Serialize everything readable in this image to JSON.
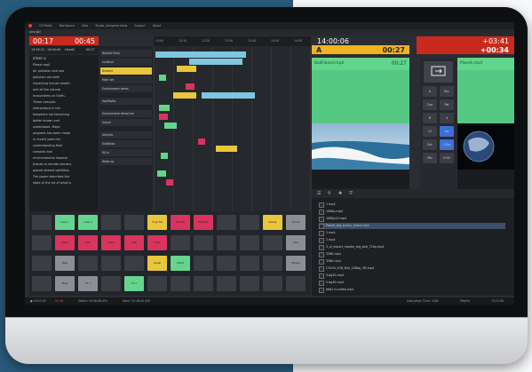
{
  "menubar": {
    "app": "OS Radio",
    "items": [
      "Workspace",
      "Help",
      "Studio, designed show",
      "Support",
      "About"
    ]
  },
  "subbar": {
    "label": "one.gbl"
  },
  "left": {
    "time_left": "00:17",
    "time_right": "00:45",
    "head": [
      "13:59:31",
      "14:00:06",
      "Head2",
      "00:17"
    ],
    "script_title": "STEST 4",
    "script_lines": [
      "Planet.mp4",
      "Air pollution and sea",
      "pollution are both",
      "impacting human health",
      "and all the natural",
      "ecosystems on Earth.",
      "These complex",
      "interactions in the",
      "biosphere are becoming",
      "better known and",
      "understood. Major",
      "progress has been made",
      "in recent years for",
      "understanding their",
      "complex and",
      "environmental impacts",
      "thanks to remote sensors",
      "placed aboard satellites.",
      "The paper describes the",
      "state of the art of what is"
    ]
  },
  "playlist": {
    "items": [
      "Ball/fall 5min",
      "Lo-Band",
      "Breaker",
      "Main set",
      "Environment demo",
      "Vox/Radio",
      "Environment demo live",
      "Sound",
      "Ad/intro",
      "Ext/News",
      "Fill-in",
      "Wake up"
    ]
  },
  "timeline": {
    "ticks": [
      "13:00",
      "13:10",
      "13:20",
      "13:30",
      "13:40",
      "13:50",
      "14:00"
    ]
  },
  "right": {
    "clock": "14:00:06",
    "countdown": "+03:41",
    "deck_a_letter": "A",
    "deck_a_time": "00:27",
    "deck_b_time": "+00:34",
    "deck_a_file": "BallFlared.mp4",
    "deck_a_duration": "00:27",
    "deck_b_file": "Planet.mp4",
    "deck_b_duration": "",
    "controls": [
      "A",
      "Esc",
      "Cue",
      "Pst",
      "B",
      "4",
      "12",
      "Ins",
      "Ext",
      "F-Out",
      "Mix",
      "0:00"
    ]
  },
  "pads": {
    "labels": [
      "Loop 1",
      "Loop 2",
      "Loop 3",
      "Loop 4",
      "Vinyl Hit",
      "Top Hit",
      "Fanfare",
      "Sweep",
      "Chime",
      "Alarm",
      "Kick",
      "Snare",
      "Clap",
      "Crash",
      "Intro",
      "Bass",
      "Laugh",
      "Shout",
      "Stinger",
      "Wipe",
      "FX 1",
      "FX 2"
    ]
  },
  "files": {
    "tools": [
      "☰",
      "⚲",
      "✚",
      "⛛"
    ],
    "items": [
      "1.mp4",
      "1080p.mp4",
      "1080p10.mp4",
      "Planet_big_bunny_trailer.mp4",
      "2.mp4",
      "2.mp4",
      "3_ai_export_master_big_bad_720p.mp4",
      "3360.mp4",
      "3360.mp4",
      "C5430_VCB_Ball_1080p_3M.mp4",
      "5.bg20.mp4",
      "5.bg30.mp4",
      "bbb2.m-video.mp4"
    ],
    "selected_index": 3
  },
  "status": {
    "items": [
      "● 16:07:00",
      "On Air",
      "Status: 16:08:46 4Tb",
      "Done: 32:18:00 ASR",
      "Auto plays 72min 128h",
      "Playlist",
      "13:21:08"
    ]
  },
  "colors": {
    "accent_red": "#c92a1e",
    "deck_yellow": "#f0b21f",
    "cue_green": "#63d48b",
    "pink": "#d9345e"
  }
}
